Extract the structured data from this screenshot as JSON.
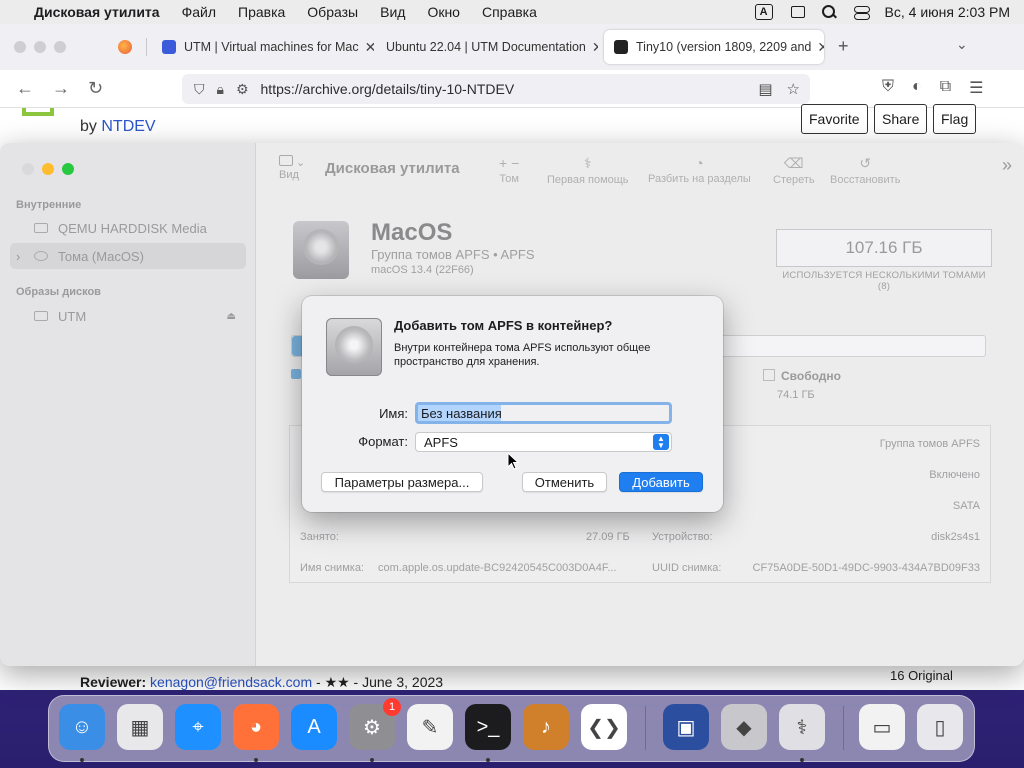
{
  "menubar": {
    "app_name": "Дисковая утилита",
    "menus": [
      "Файл",
      "Правка",
      "Образы",
      "Вид",
      "Окно",
      "Справка"
    ],
    "input_indicator": "A",
    "datetime": "Вс, 4 июня  2:03 PM"
  },
  "browser": {
    "tabs": [
      {
        "title": "UTM | Virtual machines for Mac",
        "favicon_color": "#3b5bdb"
      },
      {
        "title": "Ubuntu 22.04 | UTM Documentation",
        "favicon_color": ""
      },
      {
        "title": "Tiny10 (version 1809, 2209 and",
        "favicon_color": "#222222",
        "active": true
      }
    ],
    "url": "https://archive.org/details/tiny-10-NTDEV",
    "page": {
      "by_prefix": "by",
      "author": "NTDEV",
      "buttons": [
        "Favorite",
        "Share",
        "Flag"
      ],
      "reviewer_label": "Reviewer:",
      "reviewer_email": "kenagon@friendsack.com",
      "reviewer_rest": " - ★★ - June 3, 2023",
      "original_count": "16 Original"
    }
  },
  "disk_utility": {
    "sidebar": {
      "internal_header": "Внутренние",
      "images_header": "Образы дисков",
      "items": [
        {
          "label": "QEMU HARDDISK Media"
        },
        {
          "label": "Тома (MacOS)"
        },
        {
          "label": "UTM"
        }
      ]
    },
    "toolbar": {
      "view_label": "Вид",
      "title": "Дисковая утилита",
      "actions": [
        "Том",
        "Первая помощь",
        "Разбить на разделы",
        "Стереть",
        "Восстановить"
      ]
    },
    "volume": {
      "name": "MacOS",
      "subtitle": "Группа томов APFS • APFS",
      "os": "macOS 13.4 (22F66)",
      "capacity": "107.16 ГБ",
      "capacity_note": "ИСПОЛЬЗУЕТСЯ НЕСКОЛЬКИМИ ТОМАМИ (8)",
      "free_label": "Свободно",
      "free_value": "74.1 ГБ",
      "used_fraction": 0.25
    },
    "info": {
      "used_label": "Занято:",
      "used_value": "27.09 ГБ",
      "snapshot_label": "Имя снимка:",
      "snapshot_value": "com.apple.os.update-BC92420545C003D0A4F...",
      "type_value": "Группа томов APFS",
      "owners_value": "Включено",
      "connection_value": "SATA",
      "device_label": "Устройство:",
      "device_value": "disk2s4s1",
      "uuid_label": "UUID снимка:",
      "uuid_value": "CF75A0DE-50D1-49DC-9903-434A7BD09F33"
    }
  },
  "dialog": {
    "title": "Добавить том APFS в контейнер?",
    "description": "Внутри контейнера тома APFS используют общее пространство для хранения.",
    "name_label": "Имя:",
    "name_value": "Без названия",
    "format_label": "Формат:",
    "format_value": "APFS",
    "size_button": "Параметры размера...",
    "cancel_button": "Отменить",
    "add_button": "Добавить"
  },
  "dock": {
    "items": [
      {
        "name": "finder",
        "color": "#3a8ee6"
      },
      {
        "name": "launchpad",
        "color": "#e8e8ea"
      },
      {
        "name": "safari",
        "color": "#1e90ff"
      },
      {
        "name": "firefox",
        "color": "#ff7139"
      },
      {
        "name": "app-store",
        "color": "#1a8cff"
      },
      {
        "name": "system-settings",
        "color": "#8e8e93",
        "badge": "1"
      },
      {
        "name": "textedit",
        "color": "#f2f2f2"
      },
      {
        "name": "terminal",
        "color": "#1c1c1e"
      },
      {
        "name": "garageband",
        "color": "#d0802a"
      },
      {
        "name": "vscode",
        "color": "#ffffff"
      },
      {
        "name": "utm",
        "color": "#2b4f9e"
      },
      {
        "name": "boot-camp",
        "color": "#c8c8cc"
      },
      {
        "name": "disk-utility",
        "color": "#e0e0e4"
      },
      {
        "name": "downloads",
        "color": "#f2f2f2"
      },
      {
        "name": "trash",
        "color": "#e8e8ec"
      }
    ]
  }
}
